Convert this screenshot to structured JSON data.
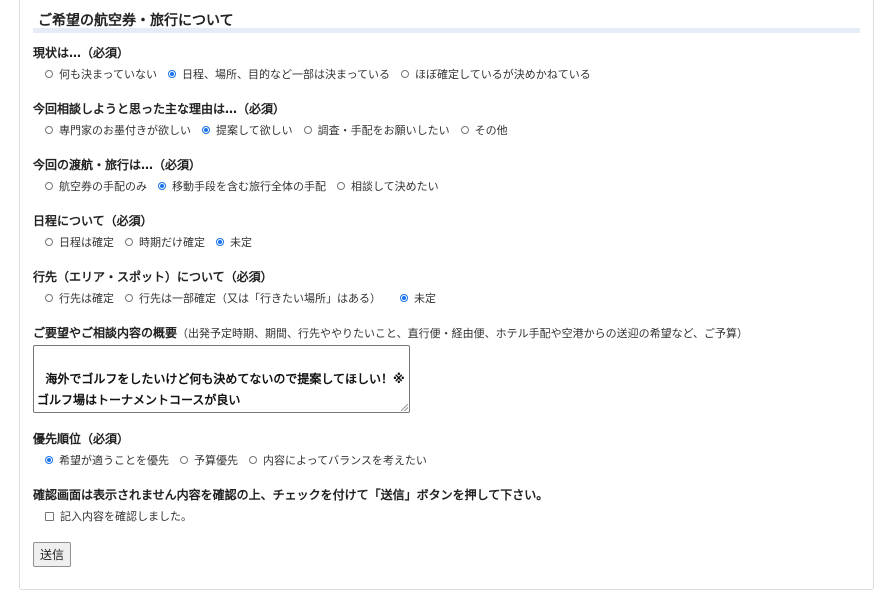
{
  "section": {
    "title": "ご希望の航空券・旅行について"
  },
  "questions": [
    {
      "label": "現状は…（必須）",
      "options": [
        {
          "label": "何も決まっていない",
          "checked": false
        },
        {
          "label": "日程、場所、目的など一部は決まっている",
          "checked": true
        },
        {
          "label": "ほぼ確定しているが決めかねている",
          "checked": false
        }
      ]
    },
    {
      "label": "今回相談しようと思った主な理由は…（必須）",
      "options": [
        {
          "label": "専門家のお墨付きが欲しい",
          "checked": false
        },
        {
          "label": "提案して欲しい",
          "checked": true
        },
        {
          "label": "調査・手配をお願いしたい",
          "checked": false
        },
        {
          "label": "その他",
          "checked": false
        }
      ]
    },
    {
      "label": "今回の渡航・旅行は…（必須）",
      "options": [
        {
          "label": "航空券の手配のみ",
          "checked": false
        },
        {
          "label": "移動手段を含む旅行全体の手配",
          "checked": true
        },
        {
          "label": "相談して決めたい",
          "checked": false
        }
      ]
    },
    {
      "label": "日程について（必須）",
      "options": [
        {
          "label": "日程は確定",
          "checked": false
        },
        {
          "label": "時期だけ確定",
          "checked": false
        },
        {
          "label": "未定",
          "checked": true
        }
      ]
    },
    {
      "label": "行先（エリア・スポット）について（必須）",
      "options": [
        {
          "label": "行先は確定",
          "checked": false
        },
        {
          "label": "行先は一部確定（又は「行きたい場所」はある）",
          "checked": false
        },
        {
          "label": "未定",
          "checked": true
        }
      ]
    }
  ],
  "overview": {
    "label": "ご要望やご相談内容の概要",
    "note": "（出発予定時期、期間、行先ややりたいこと、直行便・経由便、ホテル手配や空港からの送迎の希望など、ご予算）",
    "value": "海外でゴルフをしたいけど何も決めてないので提案してほしい！※ゴルフ場はトーナメントコースが良い"
  },
  "priority": {
    "label": "優先順位（必須）",
    "options": [
      {
        "label": "希望が適うことを優先",
        "checked": true
      },
      {
        "label": "予算優先",
        "checked": false
      },
      {
        "label": "内容によってバランスを考えたい",
        "checked": false
      }
    ]
  },
  "confirm": {
    "instruction": "確認画面は表示されません内容を確認の上、チェックを付けて「送信」ボタンを押して下さい。",
    "checkbox_label": "記入内容を確認しました。",
    "checked": false
  },
  "submit_label": "送信",
  "colors": {
    "accent": "#1a73e8",
    "title_rule": "#e5ecf7"
  }
}
